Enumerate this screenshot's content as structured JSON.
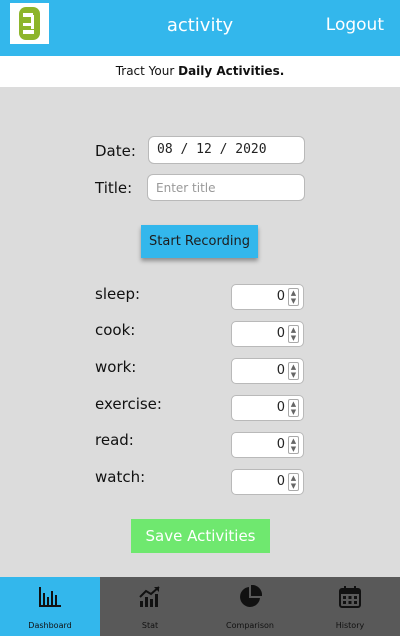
{
  "header": {
    "title": "activity",
    "logout_label": "Logout"
  },
  "tagline": {
    "prefix": "Tract Your ",
    "bold": "Daily Activities."
  },
  "form": {
    "date_label": "Date:",
    "date_value": "08 / 12 / 2020",
    "title_label": "Title:",
    "title_placeholder": "Enter title",
    "start_label": "Start Recording"
  },
  "activities": [
    {
      "label": "sleep:",
      "value": "0"
    },
    {
      "label": "cook:",
      "value": "0"
    },
    {
      "label": "work:",
      "value": "0"
    },
    {
      "label": "exercise:",
      "value": "0"
    },
    {
      "label": "read:",
      "value": "0"
    },
    {
      "label": "watch:",
      "value": "0"
    }
  ],
  "save_label": "Save Activities",
  "tabs": [
    {
      "label": "Dashboard",
      "icon": "bar-chart-icon"
    },
    {
      "label": "Stat",
      "icon": "trend-chart-icon"
    },
    {
      "label": "Comparison",
      "icon": "pie-chart-icon"
    },
    {
      "label": "History",
      "icon": "calendar-icon"
    }
  ],
  "colors": {
    "accent": "#33b7ec",
    "save": "#6fe86f",
    "logo": "#8db52b",
    "tabbar": "#595959",
    "background": "#dcdcdc"
  }
}
